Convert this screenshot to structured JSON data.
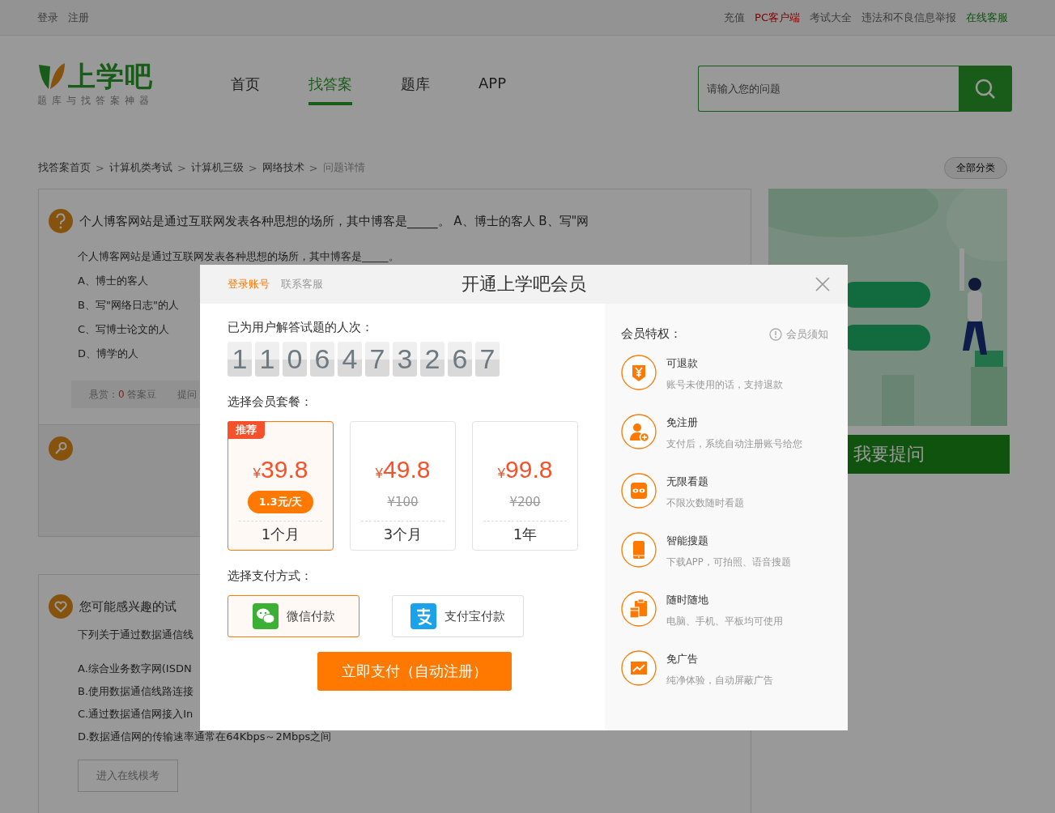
{
  "top_bar": {
    "left_links": [
      "登录",
      "注册"
    ],
    "right_links": [
      {
        "label": "充值",
        "kind": "plain"
      },
      {
        "label": "PC客户端",
        "kind": "highlight"
      },
      {
        "label": "考试大全",
        "kind": "plain"
      },
      {
        "label": "违法和不良信息举报",
        "kind": "plain"
      },
      {
        "label": "在线客服",
        "kind": "service"
      }
    ]
  },
  "header": {
    "logo": {
      "name": "上学吧",
      "slogan": "题库与找答案神器"
    },
    "nav": [
      {
        "label": "首页",
        "selected": false
      },
      {
        "label": "找答案",
        "selected": true
      },
      {
        "label": "题库",
        "selected": false
      },
      {
        "label": "APP",
        "selected": false
      }
    ],
    "search": {
      "placeholder": "请输入您的问题"
    }
  },
  "breadcrumb": {
    "items": [
      {
        "label": "找答案首页",
        "separator": ">"
      },
      {
        "label": "计算机类考试",
        "separator": ">"
      },
      {
        "label": "计算机三级",
        "separator": ">"
      },
      {
        "label": "网络技术",
        "separator": ">"
      }
    ],
    "current": "问题详情",
    "all_categories": "全部分类"
  },
  "question": {
    "title": "个人博客网站是通过互联网发表各种思想的场所，其中博客是_____。 A、博士的客人 B、写\"网",
    "text": "个人博客网站是通过互联网发表各种思想的场所，其中博客是_____。",
    "options": [
      "A、博士的客人",
      "B、写\"网络日志\"的人",
      "C、写博士论文的人",
      "D、博学的人"
    ],
    "reward_label": "悬赏：",
    "reward": "0",
    "reward_unit": "答案豆",
    "asker": "提问"
  },
  "related": {
    "title": "您可能感兴趣的试",
    "intro": "下列关于通过数据通信线",
    "options": [
      "A.综合业务数字网(ISDN",
      "B.使用数据通信线路连接",
      "C.通过数据通信网接入In",
      "D.数据通信网的传输速率通常在64Kbps～2Mbps之间"
    ],
    "button": "进入在线模考"
  },
  "sidebar": {
    "ask_button": "我要提问"
  },
  "modal": {
    "tabs": [
      {
        "label": "登录账号",
        "selected": true
      },
      {
        "label": "联系客服",
        "selected": false
      }
    ],
    "title": "开通上学吧会员",
    "count_label": "已为用户解答试题的人次：",
    "count_digits": [
      "1",
      "1",
      "0",
      "6",
      "4",
      "7",
      "3",
      "2",
      "6",
      "7"
    ],
    "plan_label": "选择会员套餐：",
    "plans": [
      {
        "badge": "推荐",
        "currency": "¥",
        "price": "39.8",
        "daily_price": "1.3元/天",
        "period": "1个月",
        "selected": true
      },
      {
        "currency": "¥",
        "price": "49.8",
        "original_price": "¥100",
        "period": "3个月",
        "selected": false
      },
      {
        "currency": "¥",
        "price": "99.8",
        "original_price": "¥200",
        "period": "1年",
        "selected": false
      }
    ],
    "payment_label": "选择支付方式：",
    "payments": [
      {
        "label": "微信付款",
        "kind": "wechat",
        "selected": true
      },
      {
        "label": "支付宝付款",
        "kind": "alipay",
        "selected": false
      }
    ],
    "pay_button": "立即支付（自动注册）",
    "perks_title": "会员特权：",
    "notice_link": "会员须知",
    "perks": [
      {
        "title": "可退款",
        "desc": "账号未使用的话，支持退款",
        "kind": "refund"
      },
      {
        "title": "免注册",
        "desc": "支付后，系统自动注册账号给您",
        "kind": "register"
      },
      {
        "title": "无限看题",
        "desc": "不限次数随时看题",
        "kind": "view"
      },
      {
        "title": "智能搜题",
        "desc": "下载APP，可拍照、语音搜题",
        "kind": "search"
      },
      {
        "title": "随时随地",
        "desc": "电脑、手机、平板均可使用",
        "kind": "devices"
      },
      {
        "title": "免广告",
        "desc": "纯净体验，自动屏蔽广告",
        "kind": "noads"
      }
    ]
  }
}
